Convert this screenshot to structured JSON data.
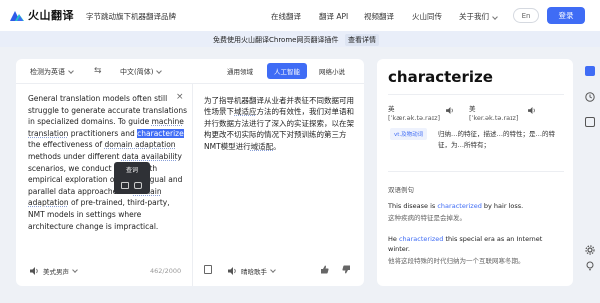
{
  "header": {
    "logo_text": "火山翻译",
    "tagline": "字节跳动旗下机器翻译品牌",
    "nav": [
      "在线翻译",
      "翻译 API",
      "视频翻译",
      "火山同传",
      "关于我们"
    ],
    "lang_label": "En",
    "login_label": "登录"
  },
  "banner": {
    "text": "免费使用火山翻译Chrome网页翻译插件",
    "link": "查看详情"
  },
  "toolbar": {
    "source_lang": "检测为英语",
    "target_lang": "中文(简体)",
    "domains": [
      "通用领域",
      "人工智能",
      "网络小说"
    ],
    "active_domain_index": 1
  },
  "source": {
    "text_parts": [
      {
        "t": "General translation models often still struggle to generate accurate translations in spec",
        "s": "plain"
      },
      {
        "t": "ialized domains. To guide ",
        "s": "plain"
      },
      {
        "t": "machine translation",
        "s": "ul"
      },
      {
        "t": " practitioners and ",
        "s": "plain"
      },
      {
        "t": "characterize",
        "s": "hl"
      },
      {
        "t": " the effectiveness of ",
        "s": "plain"
      },
      {
        "t": "domain adaptation",
        "s": "ul"
      },
      {
        "t": " methods under different ",
        "s": "plain"
      },
      {
        "t": "data availability",
        "s": "ul"
      },
      {
        "t": " scenarios, we conduct an in-depth empirical exploration of monolingual and parallel data approaches to ",
        "s": "plain"
      },
      {
        "t": "domain adaptation",
        "s": "ul"
      },
      {
        "t": " of pre-trained, third-party, NMT models in settings where architecture change is impractical.",
        "s": "plain"
      }
    ],
    "char_count": "462/2000",
    "voice_label": "美式男声",
    "popup_label": "查词"
  },
  "target": {
    "text_parts": [
      {
        "t": "为了指导机器翻译从业者并表征不同数据可用性场景下",
        "s": "plain"
      },
      {
        "t": "域适应",
        "s": "ul"
      },
      {
        "t": "方法的有效性，我们对单语和并行数据方法进行了深入的实证探索，以在架构更改不切实际的情况下对预训练的第三方NMT模型进行",
        "s": "plain"
      },
      {
        "t": "域适配",
        "s": "ul"
      },
      {
        "t": "。",
        "s": "plain"
      }
    ],
    "voice_label": "晴晗歌手"
  },
  "dictionary": {
    "word": "characterize",
    "uk_label": "英",
    "uk_phonetic": "[ˈkær.ək.tə.raɪz]",
    "us_label": "美",
    "us_phonetic": "[ˈker.ək.tə.raɪz]",
    "pos": "vt.及物动词",
    "definition": "归纳…的特征，描述…的特性；是…的特征，为…所特有；",
    "examples_title": "双语例句",
    "examples": [
      {
        "en_before": "This disease is ",
        "kw": "characterized",
        "en_after": " by hair loss.",
        "zh": "这种疾病的特征是会掉发。"
      },
      {
        "en_before": "He ",
        "kw": "characterized",
        "en_after": " this special era as an Internet winter.",
        "zh": "他将这段特殊的时代归纳为一个互联网寒冬期。"
      }
    ]
  },
  "colors": {
    "accent": "#3f6cf5",
    "bg": "#eef1f6"
  }
}
